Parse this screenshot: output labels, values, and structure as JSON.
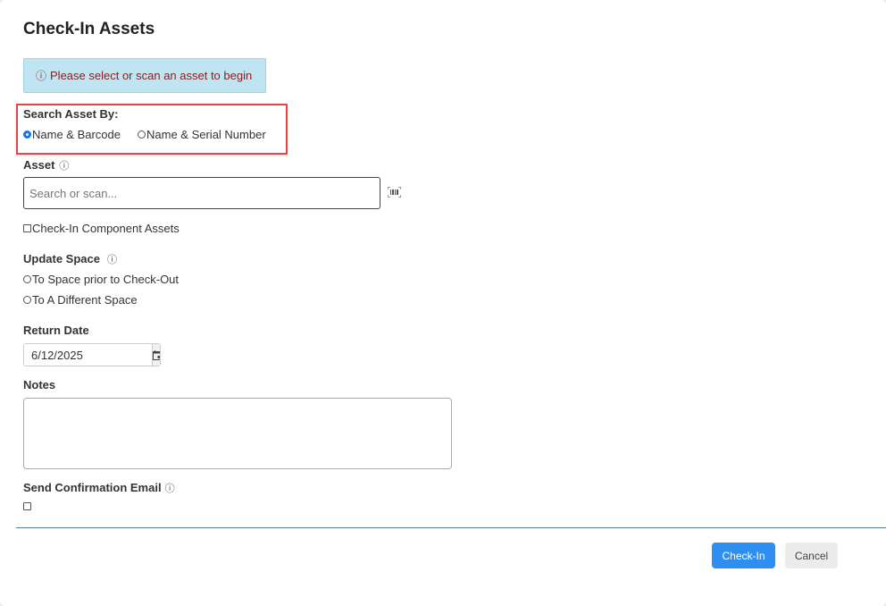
{
  "dialog": {
    "title": "Check-In Assets",
    "alert": {
      "icon": "info-circle-icon",
      "glyph": "ⓘ",
      "text": "Please select or scan an asset to begin"
    }
  },
  "search_by": {
    "label": "Search Asset By:",
    "options": [
      {
        "label": "Name & Barcode",
        "selected": true
      },
      {
        "label": "Name & Serial Number",
        "selected": false
      }
    ]
  },
  "asset": {
    "label": "Asset",
    "info_glyph": "ⓘ",
    "placeholder": "Search or scan...",
    "value": ""
  },
  "component_assets": {
    "label": "Check-In Component Assets",
    "checked": false
  },
  "update_space": {
    "label": "Update Space",
    "info_glyph": "ⓘ",
    "options": [
      {
        "label": "To Space prior to Check-Out",
        "selected": false
      },
      {
        "label": "To A Different Space",
        "selected": false
      }
    ]
  },
  "return_date": {
    "label": "Return Date",
    "value": "6/12/2025"
  },
  "notes": {
    "label": "Notes",
    "value": ""
  },
  "confirmation_email": {
    "label": "Send Confirmation Email",
    "info_glyph": "ⓘ",
    "checked": false
  },
  "footer": {
    "primary_label": "Check-In",
    "secondary_label": "Cancel"
  },
  "colors": {
    "primary": "#2f8ff0",
    "alert_bg": "#bfe4f2",
    "alert_text": "#8a1c1c",
    "highlight": "#e04848"
  }
}
